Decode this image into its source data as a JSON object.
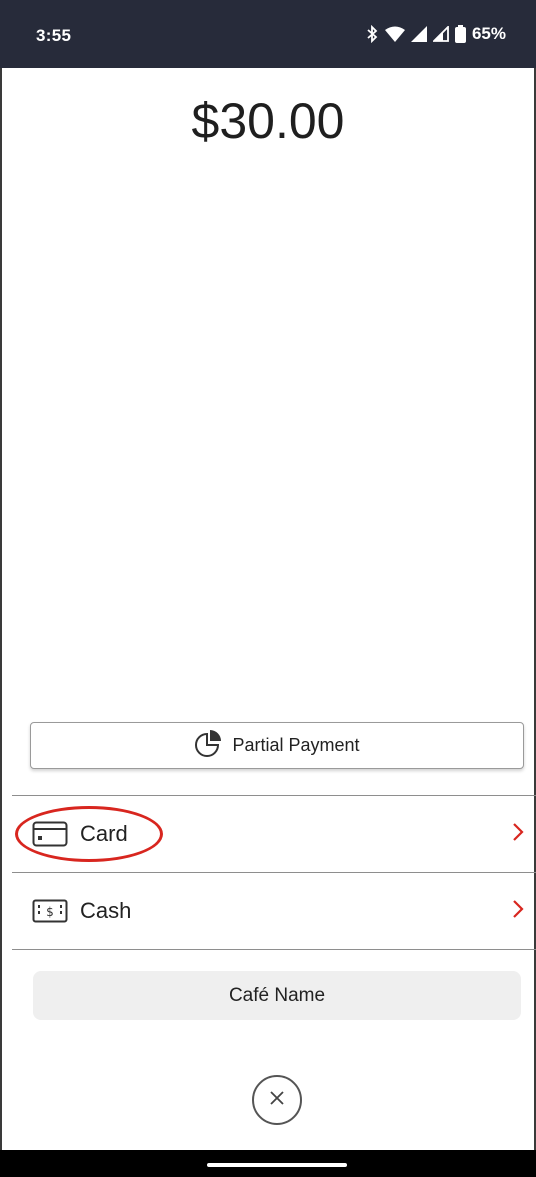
{
  "status_bar": {
    "time": "3:55",
    "battery": "65%",
    "icons": [
      "bluetooth-icon",
      "wifi-icon",
      "signal-icon",
      "signal-icon",
      "battery-icon"
    ]
  },
  "payment": {
    "amount": "$30.00",
    "partial_payment_label": "Partial Payment",
    "methods": [
      {
        "label": "Card",
        "icon": "credit-card-icon"
      },
      {
        "label": "Cash",
        "icon": "cash-icon"
      }
    ],
    "cafe_name_label": "Café Name"
  },
  "colors": {
    "status_bar_bg": "#272b3a",
    "accent_red": "#d8261f",
    "button_gray": "#efefef"
  }
}
